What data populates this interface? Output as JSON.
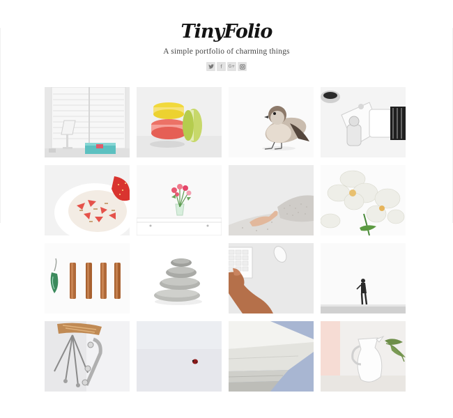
{
  "site": {
    "logo": "TinyFolio",
    "tagline": "A simple portfolio of charming things"
  },
  "social": [
    {
      "name": "twitter",
      "glyph": "•"
    },
    {
      "name": "facebook",
      "glyph": "f"
    },
    {
      "name": "google-plus",
      "glyph": "G+"
    },
    {
      "name": "instagram",
      "glyph": "▣"
    }
  ],
  "gallery": [
    {
      "subject": "window-lamp"
    },
    {
      "subject": "macarons"
    },
    {
      "subject": "sparrow"
    },
    {
      "subject": "camera"
    },
    {
      "subject": "yogurt-strawberries"
    },
    {
      "subject": "flower-vase"
    },
    {
      "subject": "hand-on-bed"
    },
    {
      "subject": "orchid"
    },
    {
      "subject": "cinnamon-sticks"
    },
    {
      "subject": "stacked-stones"
    },
    {
      "subject": "keyboard-mouse"
    },
    {
      "subject": "figure-on-ledge"
    },
    {
      "subject": "tripod-chair"
    },
    {
      "subject": "ladybug"
    },
    {
      "subject": "architecture"
    },
    {
      "subject": "white-jug"
    }
  ]
}
